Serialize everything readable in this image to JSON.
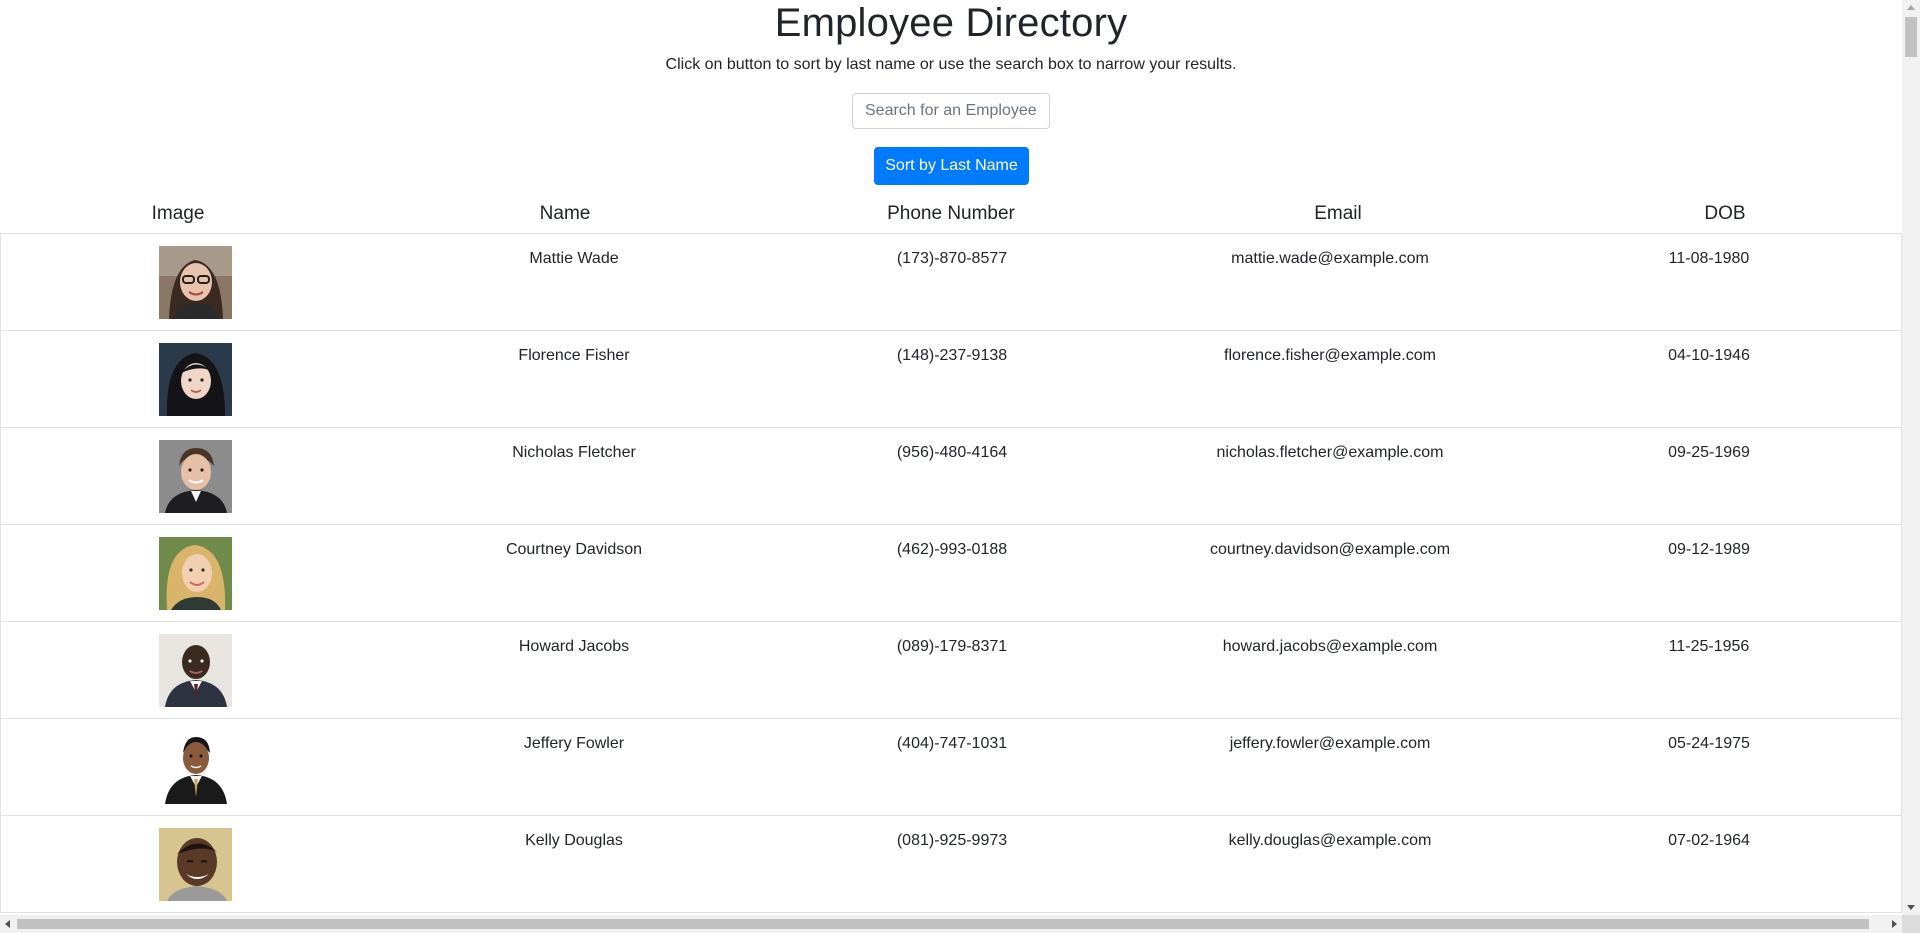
{
  "header": {
    "title": "Employee Directory",
    "subtitle": "Click on button to sort by last name or use the search box to narrow your results."
  },
  "search": {
    "placeholder": "Search for an Employee",
    "value": ""
  },
  "sort_button": {
    "label": "Sort by Last Name",
    "color": "#007bff"
  },
  "table": {
    "columns": [
      "Image",
      "Name",
      "Phone Number",
      "Email",
      "DOB"
    ],
    "rows": [
      {
        "name": "Mattie Wade",
        "phone": "(173)-870-8577",
        "email": "mattie.wade@example.com",
        "dob": "11-08-1980"
      },
      {
        "name": "Florence Fisher",
        "phone": "(148)-237-9138",
        "email": "florence.fisher@example.com",
        "dob": "04-10-1946"
      },
      {
        "name": "Nicholas Fletcher",
        "phone": "(956)-480-4164",
        "email": "nicholas.fletcher@example.com",
        "dob": "09-25-1969"
      },
      {
        "name": "Courtney Davidson",
        "phone": "(462)-993-0188",
        "email": "courtney.davidson@example.com",
        "dob": "09-12-1989"
      },
      {
        "name": "Howard Jacobs",
        "phone": "(089)-179-8371",
        "email": "howard.jacobs@example.com",
        "dob": "11-25-1956"
      },
      {
        "name": "Jeffery Fowler",
        "phone": "(404)-747-1031",
        "email": "jeffery.fowler@example.com",
        "dob": "05-24-1975"
      },
      {
        "name": "Kelly Douglas",
        "phone": "(081)-925-9973",
        "email": "kelly.douglas@example.com",
        "dob": "07-02-1964"
      }
    ]
  }
}
